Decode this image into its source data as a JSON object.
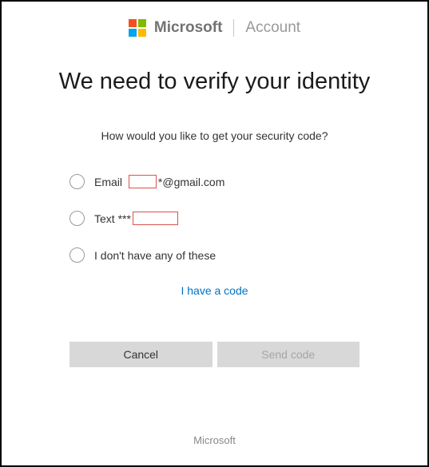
{
  "header": {
    "brand": "Microsoft",
    "section": "Account"
  },
  "title": "We need to verify your identity",
  "subtitle": "How would you like to get your security code?",
  "options": {
    "email": {
      "prefix": "Email",
      "suffix": "*@gmail.com"
    },
    "text": {
      "prefix": "Text ***"
    },
    "none": {
      "label": "I don't have any of these"
    }
  },
  "link": {
    "have_code": "I have a code"
  },
  "buttons": {
    "cancel": "Cancel",
    "send": "Send code"
  },
  "footer": {
    "text": "Microsoft"
  }
}
